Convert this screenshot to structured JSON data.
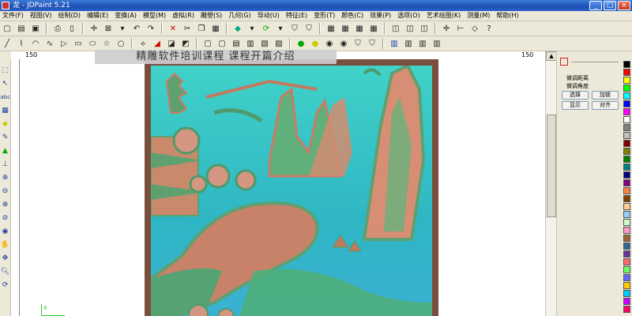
{
  "window": {
    "title": "龙 - JDPaint 5.21",
    "minimize": "_",
    "maximize": "□",
    "close": "×"
  },
  "menu": [
    "文件(F)",
    "视图(V)",
    "绘制(D)",
    "编辑(E)",
    "变换(A)",
    "模型(M)",
    "虚拟(R)",
    "雕塑(S)",
    "几何(G)",
    "导动(U)",
    "特征(E)",
    "变形(T)",
    "颜色(C)",
    "效果(P)",
    "选项(O)",
    "艺术绘图(K)",
    "测量(M)",
    "帮助(H)"
  ],
  "toolbar_row1": [
    "new-icon",
    "open-icon",
    "save-icon",
    "sep",
    "print-icon",
    "preview-icon",
    "sep",
    "add-point-icon",
    "select-box-icon",
    "dropdown-icon",
    "undo-icon",
    "redo-icon",
    "sep",
    "delete-icon",
    "cut-icon",
    "copy-icon",
    "paste-icon",
    "sep",
    "fill-icon",
    "dropdown-icon",
    "rotate-view-icon",
    "dropdown-icon",
    "shield-icon",
    "shield2-icon",
    "sep",
    "grid-icon",
    "grid2-icon",
    "grid3-icon",
    "grid4-icon",
    "sep",
    "layer-icon",
    "layer2-icon",
    "layer3-icon",
    "sep",
    "move-icon",
    "align-icon",
    "node-icon",
    "help-icon"
  ],
  "toolbar_row2": [
    "line-icon",
    "polyline-icon",
    "arc-icon",
    "curve-icon",
    "triangle-icon",
    "rect-icon",
    "ellipse-icon",
    "star-icon",
    "circle-icon",
    "sep",
    "mirror-icon",
    "mirror2-icon",
    "transform-icon",
    "transform2-icon",
    "sep",
    "rect-frame-icon",
    "rect-frame2-icon",
    "frame3-icon",
    "frame4-icon",
    "frame5-icon",
    "frame6-icon",
    "sep",
    "light-icon",
    "light2-icon",
    "light3-icon",
    "light4-icon",
    "light5-icon",
    "light6-icon",
    "sep",
    "book-icon",
    "book2-icon",
    "book3-icon",
    "book4-icon"
  ],
  "ruler": {
    "left_label": "150",
    "right_label": "150"
  },
  "banner": {
    "text": "精雕软件培训课程    课程开篇介绍"
  },
  "canvas": {
    "axis_label": "X"
  },
  "panel": {
    "label_distance": "微调距离",
    "label_angle": "微调角度",
    "btn_select": "选择",
    "btn_lock": "加锁",
    "btn_show": "显示",
    "btn_align": "对齐"
  },
  "palette_colors": [
    "#000000",
    "#ff0000",
    "#ffff00",
    "#00ff00",
    "#00ffff",
    "#0000ff",
    "#ff00ff",
    "#ffffff",
    "#808080",
    "#c0c0c0",
    "#800000",
    "#808000",
    "#008000",
    "#008080",
    "#000080",
    "#800080",
    "#ff8040",
    "#804000",
    "#ffcc99",
    "#99ccff",
    "#ccffcc",
    "#ff99cc",
    "#996633",
    "#336699",
    "#663399",
    "#ff6666",
    "#66ff66",
    "#6666ff",
    "#ffcc00",
    "#00ccff",
    "#cc00ff",
    "#ff0066"
  ]
}
